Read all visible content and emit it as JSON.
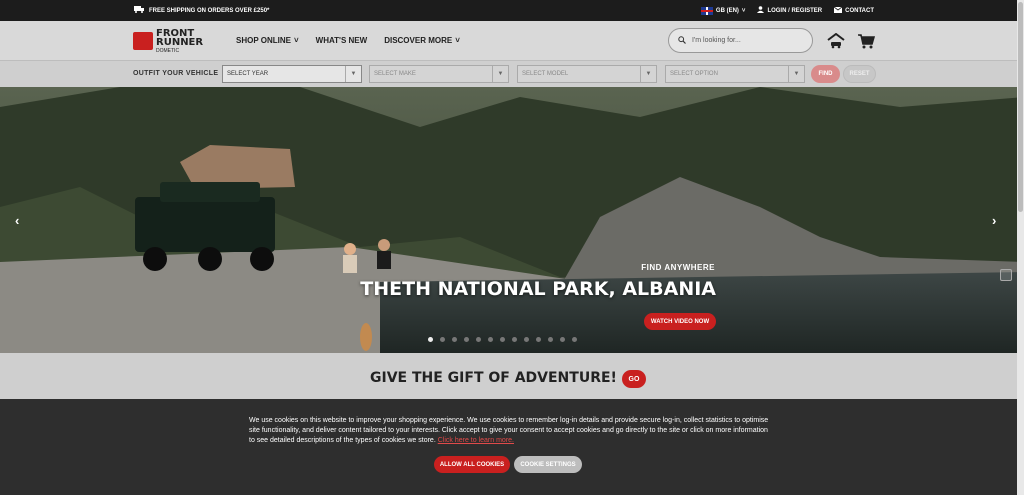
{
  "topbar": {
    "shipping": "FREE SHIPPING ON ORDERS OVER £250*",
    "locale": "GB (EN)",
    "login": "LOGIN / REGISTER",
    "contact": "CONTACT"
  },
  "header": {
    "logo_line1": "FRONT",
    "logo_line2": "RUNNER",
    "logo_sub": "DOMETIC",
    "nav": [
      {
        "label": "SHOP ONLINE"
      },
      {
        "label": "WHAT'S NEW"
      },
      {
        "label": "DISCOVER MORE"
      }
    ],
    "search_placeholder": "I'm looking for..."
  },
  "vehicle": {
    "label": "OUTFIT YOUR VEHICLE",
    "selects": [
      "SELECT YEAR",
      "SELECT MAKE",
      "SELECT MODEL",
      "SELECT OPTION"
    ],
    "find": "FIND",
    "reset": "RESET"
  },
  "hero": {
    "prev": "‹",
    "next": "›",
    "kicker": "FIND ANYWHERE",
    "title": "THETH NATIONAL PARK, ALBANIA",
    "cta": "WATCH VIDEO NOW",
    "slides": 13,
    "active_slide": 1
  },
  "gift": {
    "title": "GIVE THE GIFT OF ADVENTURE!",
    "cta": "GO"
  },
  "cookie": {
    "message": "We use cookies on this website to improve your shopping experience. We use cookies to remember log-in details and provide secure log-in, collect statistics to optimise site functionality, and deliver content tailored to your interests. Click accept to give your consent to accept cookies and go directly to the site or click on more information to see detailed descriptions of the types of cookies we store.",
    "link": "Click here to learn more.",
    "allow": "ALLOW ALL COOKIES",
    "settings": "COOKIE SETTINGS"
  },
  "colors": {
    "accent": "#c9201f",
    "topbar": "#1c1c1c",
    "cookie_bg": "#2e2e2e"
  }
}
